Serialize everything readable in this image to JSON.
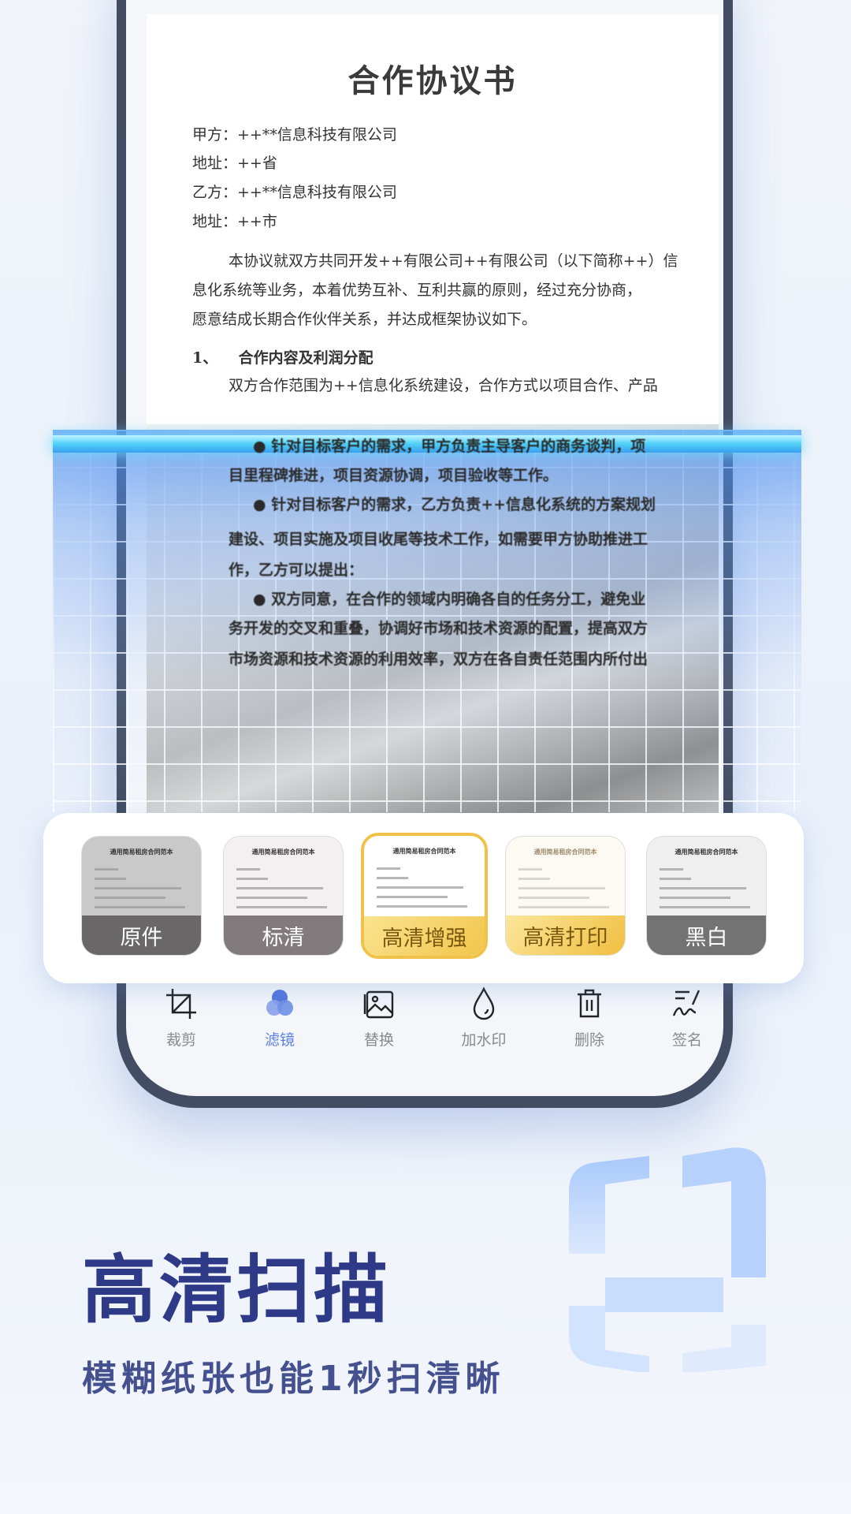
{
  "document": {
    "title": "合作协议书",
    "lines": [
      "甲方：++**信息科技有限公司",
      "地址：++省",
      "乙方：++**信息科技有限公司",
      "地址：++市"
    ],
    "paragraph": [
      "本协议就双方共同开发++有限公司++有限公司（以下简称++）信",
      "息化系统等业务，本着优势互补、互利共赢的原则，经过充分协商，",
      "愿意结成长期合作伙伴关系，并达成框架协议如下。"
    ],
    "section_heading": "1、    合作内容及利润分配",
    "section_line": "双方合作范围为++信息化系统建设，合作方式以项目合作、产品",
    "blurred_lines": [
      "●  针对目标客户的需求，甲方负责主导客户的商务谈判，项",
      "目里程碑推进，项目资源协调，项目验收等工作。",
      "●  针对目标客户的需求，乙方负责++信息化系统的方案规划",
      "建设、项目实施及项目收尾等技术工作，如需要甲方协助推进工",
      "作，乙方可以提出：",
      "●  双方同意，在合作的领域内明确各自的任务分工，避免业",
      "务开发的交叉和重叠，协调好市场和技术资源的配置，提高双方",
      "市场资源和技术资源的利用效率，双方在各自责任范围内所付出"
    ]
  },
  "filters": {
    "thumbnail_title": "通用简易租房合同范本",
    "items": [
      {
        "label": "原件",
        "selected": false
      },
      {
        "label": "标清",
        "selected": false
      },
      {
        "label": "高清增强",
        "selected": true
      },
      {
        "label": "高清打印",
        "selected": false
      },
      {
        "label": "黑白",
        "selected": false
      }
    ]
  },
  "toolbar": {
    "items": [
      {
        "label": "裁剪",
        "icon": "crop-icon",
        "active": false
      },
      {
        "label": "滤镜",
        "icon": "filter-icon",
        "active": true
      },
      {
        "label": "替换",
        "icon": "image-replace-icon",
        "active": false
      },
      {
        "label": "加水印",
        "icon": "watermark-drop-icon",
        "active": false
      },
      {
        "label": "删除",
        "icon": "trash-icon",
        "active": false
      },
      {
        "label": "签名",
        "icon": "signature-icon",
        "active": false
      }
    ],
    "active_color": "#5b7fe0"
  },
  "promo": {
    "headline": "高清扫描",
    "subheadline": "模糊纸张也能1秒扫清晰"
  }
}
